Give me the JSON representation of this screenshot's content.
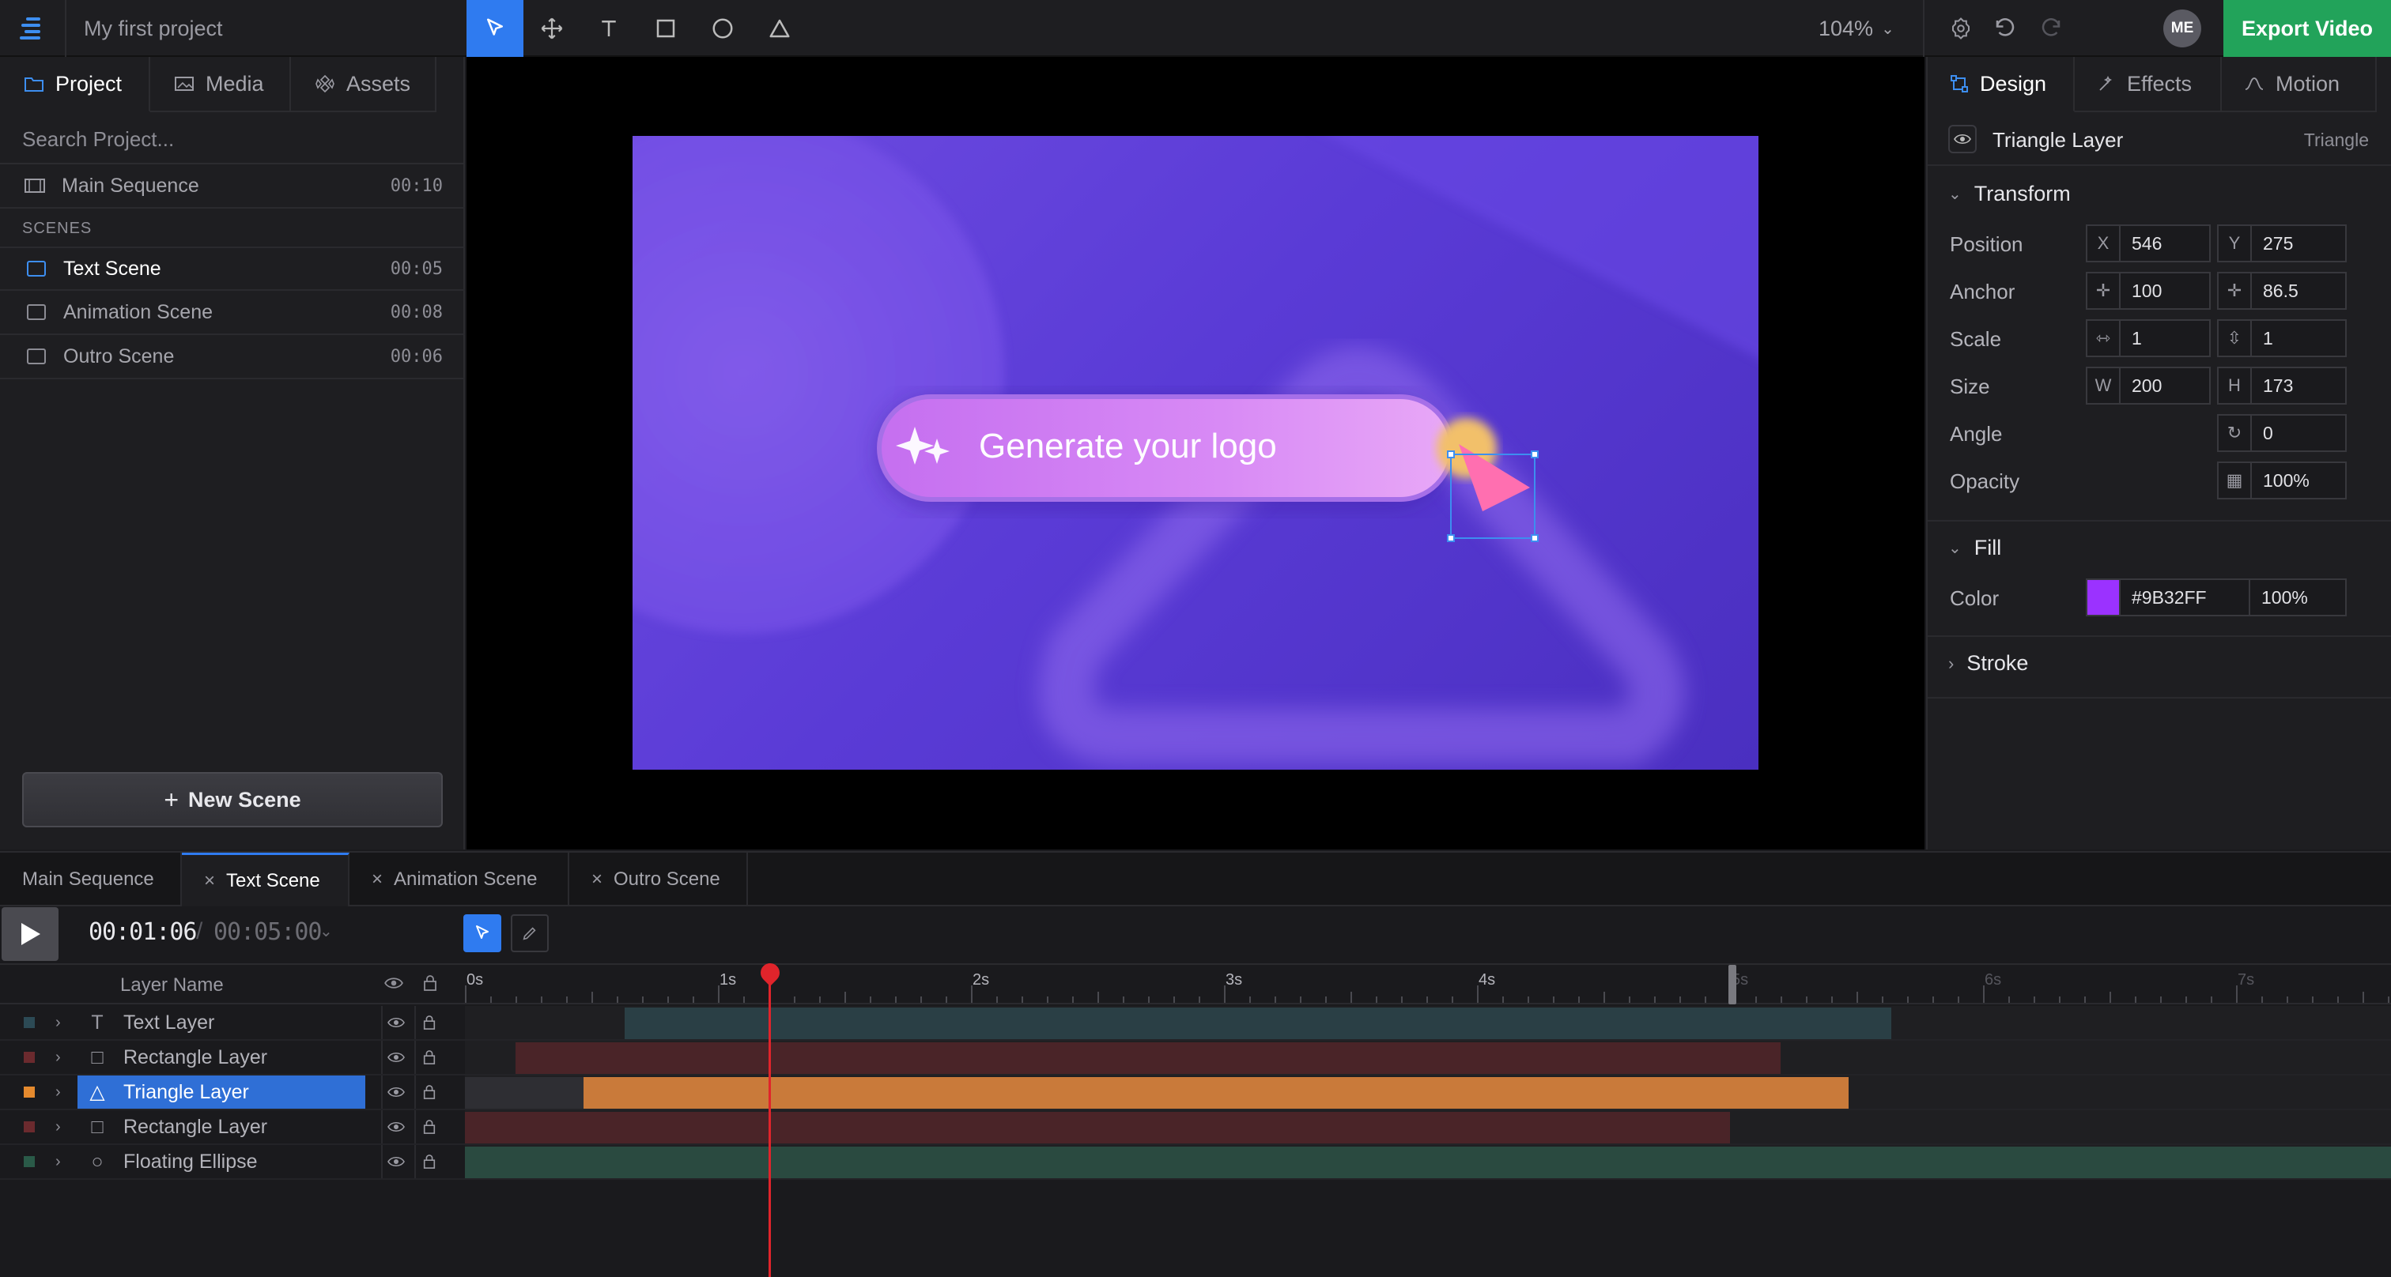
{
  "app": {
    "project_title": "My first project",
    "zoom": "104%",
    "avatar": "ME",
    "export_label": "Export Video"
  },
  "tools": [
    "pointer-tool",
    "move-tool",
    "text-tool",
    "rectangle-tool",
    "ellipse-tool",
    "triangle-tool"
  ],
  "left_panel": {
    "tabs": [
      {
        "label": "Project"
      },
      {
        "label": "Media"
      },
      {
        "label": "Assets"
      }
    ],
    "search_placeholder": "Search Project...",
    "main_sequence": {
      "label": "Main Sequence",
      "duration": "00:10"
    },
    "scenes_header": "SCENES",
    "scenes": [
      {
        "label": "Text Scene",
        "duration": "00:05"
      },
      {
        "label": "Animation Scene",
        "duration": "00:08"
      },
      {
        "label": "Outro Scene",
        "duration": "00:06"
      }
    ],
    "new_scene_label": "New Scene"
  },
  "canvas": {
    "button_text": "Generate your logo"
  },
  "right_panel": {
    "tabs": [
      {
        "label": "Design"
      },
      {
        "label": "Effects"
      },
      {
        "label": "Motion"
      }
    ],
    "layer_name": "Triangle Layer",
    "layer_type": "Triangle",
    "transform_label": "Transform",
    "position": {
      "label": "Position",
      "x_prefix": "X",
      "x": "546",
      "y_prefix": "Y",
      "y": "275"
    },
    "anchor": {
      "label": "Anchor",
      "x": "100",
      "y": "86.5"
    },
    "scale": {
      "label": "Scale",
      "x": "1",
      "y": "1"
    },
    "size": {
      "label": "Size",
      "w_prefix": "W",
      "w": "200",
      "h_prefix": "H",
      "h": "173"
    },
    "angle": {
      "label": "Angle",
      "value": "0"
    },
    "opacity": {
      "label": "Opacity",
      "value": "100%"
    },
    "fill_label": "Fill",
    "fill": {
      "label": "Color",
      "hex": "#9B32FF",
      "opacity": "100%",
      "swatch": "#9b32ff"
    },
    "stroke_label": "Stroke"
  },
  "timeline": {
    "tabs": [
      {
        "label": "Main Sequence"
      },
      {
        "label": "Text Scene"
      },
      {
        "label": "Animation Scene"
      },
      {
        "label": "Outro Scene"
      }
    ],
    "current_time": "00:01:06",
    "separator": "/",
    "total_time": "00:05:00",
    "layer_name_header": "Layer Name",
    "ruler_labels": [
      "0s",
      "1s",
      "2s",
      "3s",
      "4s",
      "5s",
      "6s",
      "7s"
    ],
    "layers": [
      {
        "name": "Text Layer",
        "type_glyph": "T",
        "color": "#2c4a55"
      },
      {
        "name": "Rectangle Layer",
        "type_glyph": "□",
        "color": "#6b2a2e"
      },
      {
        "name": "Triangle Layer",
        "type_glyph": "△",
        "color": "#e58a2e"
      },
      {
        "name": "Rectangle Layer",
        "type_glyph": "□",
        "color": "#6b2a2e"
      },
      {
        "name": "Floating Ellipse",
        "type_glyph": "○",
        "color": "#2a5a48"
      }
    ]
  },
  "colors": {
    "accent": "#2f7bf0",
    "export": "#22a35a",
    "playhead": "#e0242b"
  }
}
